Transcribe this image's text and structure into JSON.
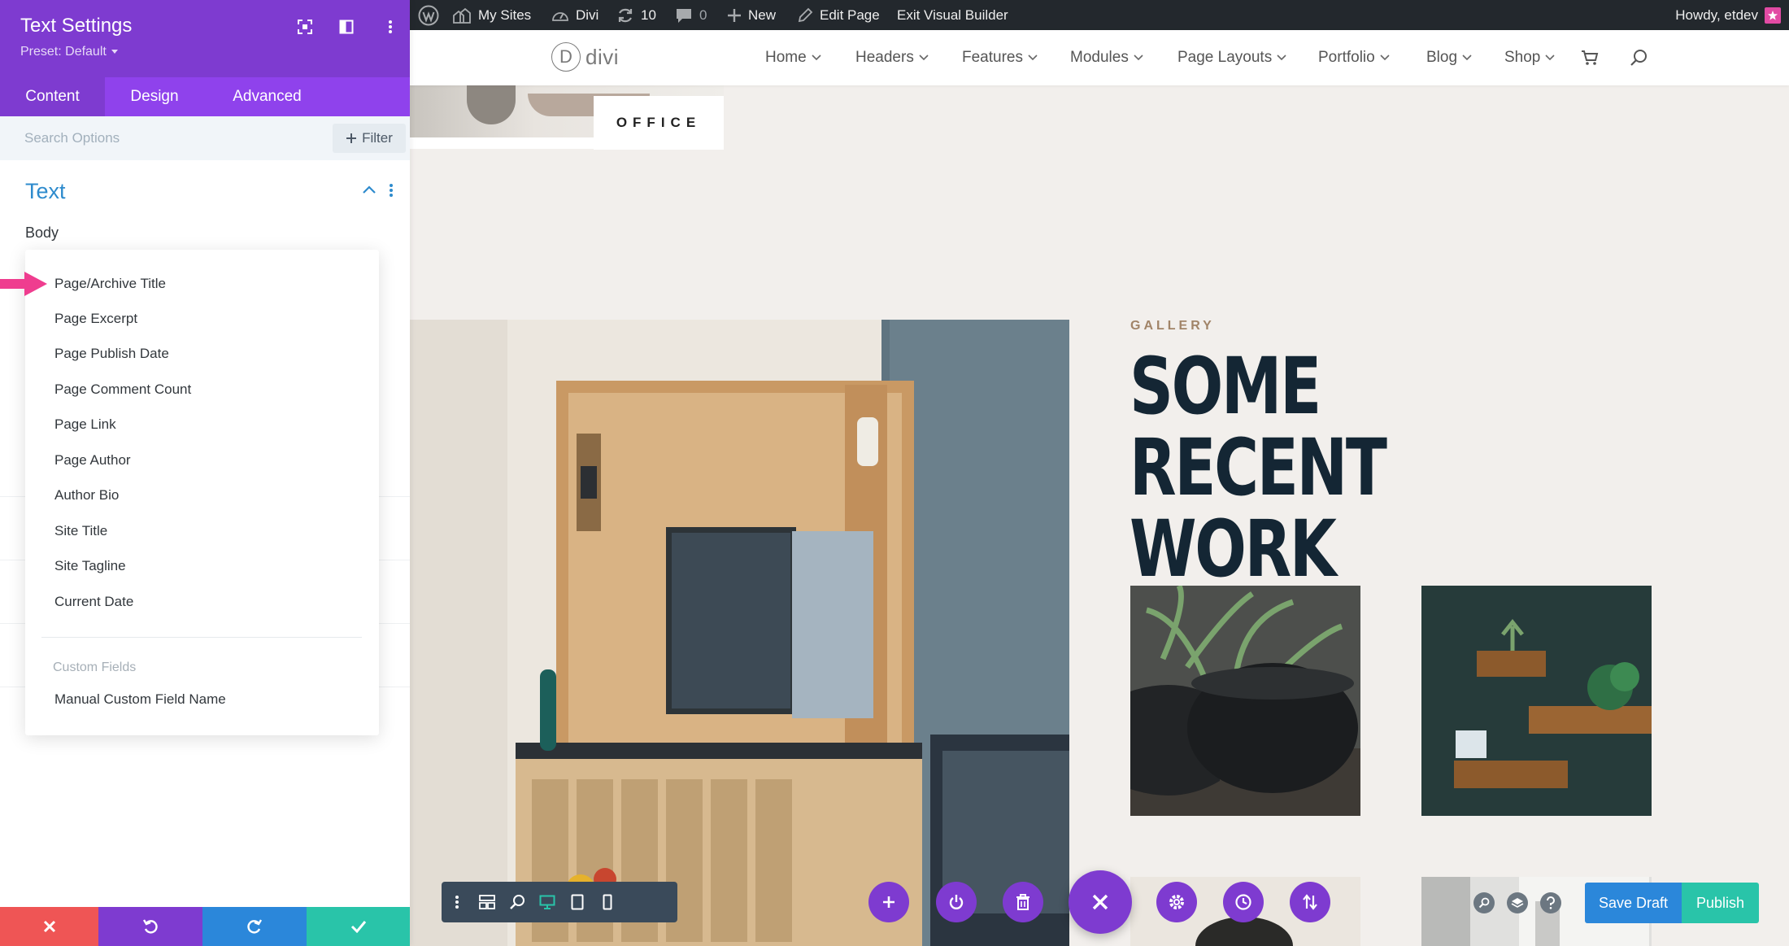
{
  "admin_bar": {
    "my_sites": "My Sites",
    "site_name": "Divi",
    "updates_count": "10",
    "comments_count": "0",
    "new_label": "New",
    "edit_page": "Edit Page",
    "exit_builder": "Exit Visual Builder",
    "howdy": "Howdy, etdev"
  },
  "site_header": {
    "logo_letter": "D",
    "logo_text": "divi",
    "nav": [
      {
        "label": "Home"
      },
      {
        "label": "Headers"
      },
      {
        "label": "Features"
      },
      {
        "label": "Modules"
      },
      {
        "label": "Page Layouts"
      },
      {
        "label": "Portfolio"
      },
      {
        "label": "Blog"
      },
      {
        "label": "Shop"
      }
    ],
    "icons": [
      "cart-icon",
      "search-icon"
    ]
  },
  "page": {
    "office_label": "OFFICE",
    "gallery_label": "GALLERY",
    "gallery_title_line1": "SOME RECENT",
    "gallery_title_line2": "WORK"
  },
  "settings_panel": {
    "title": "Text Settings",
    "preset": "Preset: Default",
    "tabs": [
      {
        "label": "Content",
        "active": true
      },
      {
        "label": "Design",
        "active": false
      },
      {
        "label": "Advanced",
        "active": false
      }
    ],
    "search_placeholder": "Search Options",
    "filter_label": "Filter",
    "section_title": "Text",
    "body_label": "Body",
    "dropdown": {
      "items": [
        "Page/Archive Title",
        "Page Excerpt",
        "Page Publish Date",
        "Page Comment Count",
        "Page Link",
        "Page Author",
        "Author Bio",
        "Site Title",
        "Site Tagline",
        "Current Date"
      ],
      "group_label": "Custom Fields",
      "group_items": [
        "Manual Custom Field Name"
      ],
      "highlighted_item": "Page/Archive Title"
    },
    "actions": [
      "close-icon",
      "undo-icon",
      "redo-icon",
      "check-icon"
    ]
  },
  "builder_bar": {
    "save_draft": "Save Draft",
    "publish": "Publish"
  },
  "colors": {
    "panel_header": "#7e3bd0",
    "panel_tabs": "#8f42ec",
    "accent_blue": "#2e8bcd",
    "action_close": "#ef5555",
    "action_undo": "#7e3bd0",
    "action_redo": "#2b87da",
    "action_save": "#29c4a9",
    "pointer_arrow": "#ef3d8f",
    "admin_bar": "#23282d",
    "gallery_title": "#142634"
  }
}
